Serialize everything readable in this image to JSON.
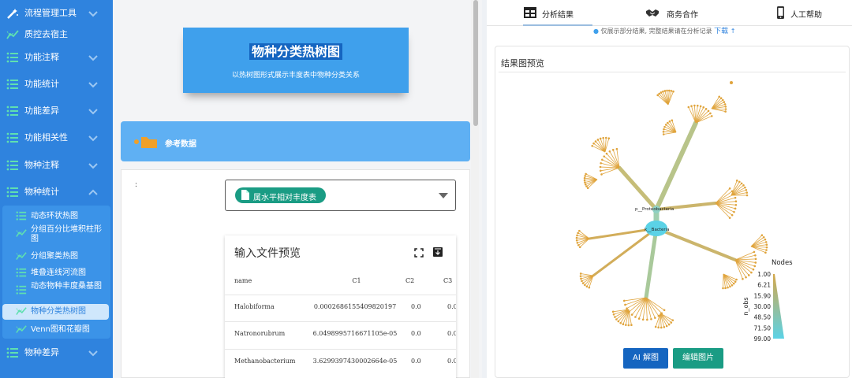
{
  "sidebar": {
    "items": [
      {
        "label": "流程管理工具",
        "icon": "magic-wand-icon",
        "has_chevron": true,
        "expanded": false
      },
      {
        "label": "质控去宿主",
        "icon": "trend-line-icon",
        "has_chevron": false
      },
      {
        "label": "功能注释",
        "icon": "list-icon",
        "has_chevron": true,
        "expanded": false
      },
      {
        "label": "功能统计",
        "icon": "list-icon",
        "has_chevron": true,
        "expanded": false
      },
      {
        "label": "功能差异",
        "icon": "list-icon",
        "has_chevron": true,
        "expanded": false
      },
      {
        "label": "功能相关性",
        "icon": "list-icon",
        "has_chevron": true,
        "expanded": false
      },
      {
        "label": "物种注释",
        "icon": "list-icon",
        "has_chevron": true,
        "expanded": false
      },
      {
        "label": "物种统计",
        "icon": "list-icon",
        "has_chevron": true,
        "expanded": true
      }
    ],
    "subitems": [
      {
        "label": "动态环状热图",
        "icon": "list-icon"
      },
      {
        "label": "分组百分比堆积柱形图",
        "icon": "trend-line-icon"
      },
      {
        "label": "分组聚类热图",
        "icon": "trend-line-icon"
      },
      {
        "label": "堆叠连线河流图",
        "icon": "list-icon"
      },
      {
        "label": "动态物种丰度桑基图",
        "icon": "list-icon"
      },
      {
        "label": "物种分类热树图",
        "icon": "trend-line-icon",
        "active": true
      },
      {
        "label": "Venn图和花瓣图",
        "icon": "trend-line-icon"
      }
    ],
    "last_item": {
      "label": "物种差异",
      "icon": "list-icon",
      "has_chevron": true
    }
  },
  "hero": {
    "title": "物种分类热树图",
    "subtitle": "以热树图形式展示丰度表中物种分类关系"
  },
  "reference": {
    "label": "参考数据",
    "icon": "folder-icon"
  },
  "form": {
    "colon": ":",
    "selected": "属水平相对丰度表"
  },
  "preview": {
    "title": "输入文件预览",
    "headers": [
      "name",
      "C1",
      "C2",
      "C3"
    ],
    "rows": [
      [
        "Halobiforma",
        "0.0002686155409820197",
        "0.0",
        "0.0"
      ],
      [
        "Natronorubrum",
        "6.0498995716671105e-05",
        "0.0",
        "0.0"
      ],
      [
        "Methanobacterium",
        "3.6299397430002664e-05",
        "0.0",
        "0.0"
      ]
    ]
  },
  "tabs": [
    {
      "label": "分析结果",
      "icon": "table-icon",
      "active": true
    },
    {
      "label": "商务合作",
      "icon": "handshake-icon"
    },
    {
      "label": "人工帮助",
      "icon": "phone-icon"
    }
  ],
  "notice": {
    "text": "仅展示部分结果, 完整结果请在分析记录",
    "link": "下载",
    "arrow": "↑"
  },
  "result": {
    "title": "结果图预览",
    "node_labels": [
      "p__Proteobacteria",
      "k__Bacteria"
    ],
    "legend": {
      "title": "Nodes",
      "axis_label": "n_obs",
      "ticks": [
        "1.00",
        "6.21",
        "15.90",
        "30.00",
        "48.50",
        "71.50",
        "99.00"
      ]
    },
    "colors": {
      "low": "#d4a84b",
      "high": "#5bd2e6",
      "branch": "#e0a43c"
    }
  },
  "buttons": {
    "ai": "AI 解图",
    "edit": "编辑图片"
  }
}
